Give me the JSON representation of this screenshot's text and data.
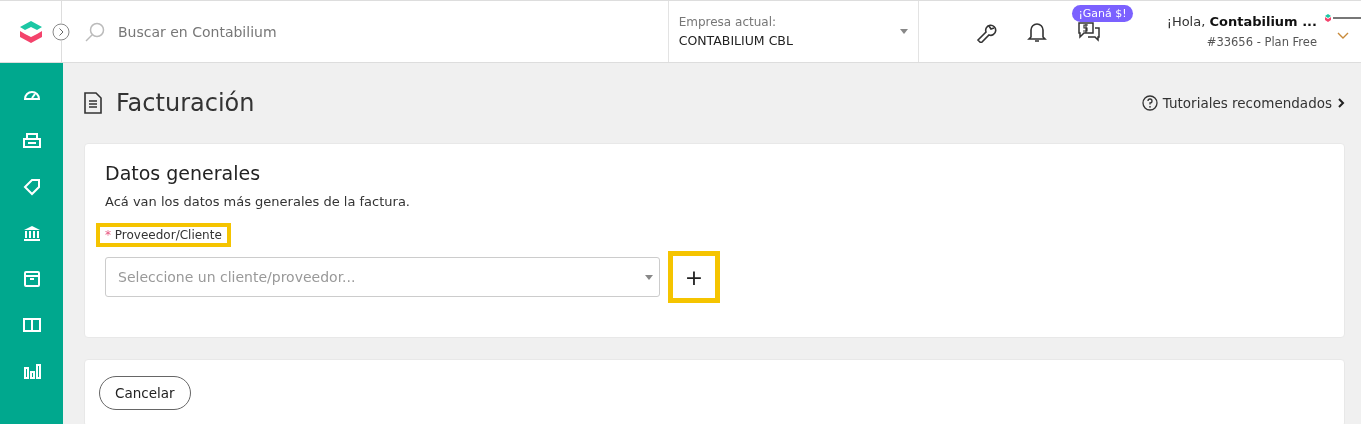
{
  "topbar": {
    "search": {
      "placeholder": "Buscar en Contabilium"
    },
    "company": {
      "label": "Empresa actual:",
      "value": "CONTABILIUM CBL"
    },
    "promo_badge": "¡Ganá $!",
    "user": {
      "greeting": "¡Hola, ",
      "name": "Contabilium ...",
      "account": "#33656 - Plan Free"
    }
  },
  "sidebar": {
    "items": [
      {
        "kind": "gauge"
      },
      {
        "kind": "printer"
      },
      {
        "kind": "tag"
      },
      {
        "kind": "bank"
      },
      {
        "kind": "box"
      },
      {
        "kind": "book"
      },
      {
        "kind": "chart"
      }
    ]
  },
  "page": {
    "title": "Facturación",
    "tutorials_link": "Tutoriales recomendados"
  },
  "general_data": {
    "title": "Datos generales",
    "description": "Acá van los datos más generales de la factura.",
    "field": {
      "label": "Proveedor/Cliente",
      "required_mark": "*",
      "highlighted": true,
      "placeholder": "Seleccione un cliente/proveedor..."
    },
    "add_button": {
      "label": "+",
      "highlighted": true
    }
  },
  "actions": {
    "buttons": [
      "Cancelar"
    ]
  }
}
